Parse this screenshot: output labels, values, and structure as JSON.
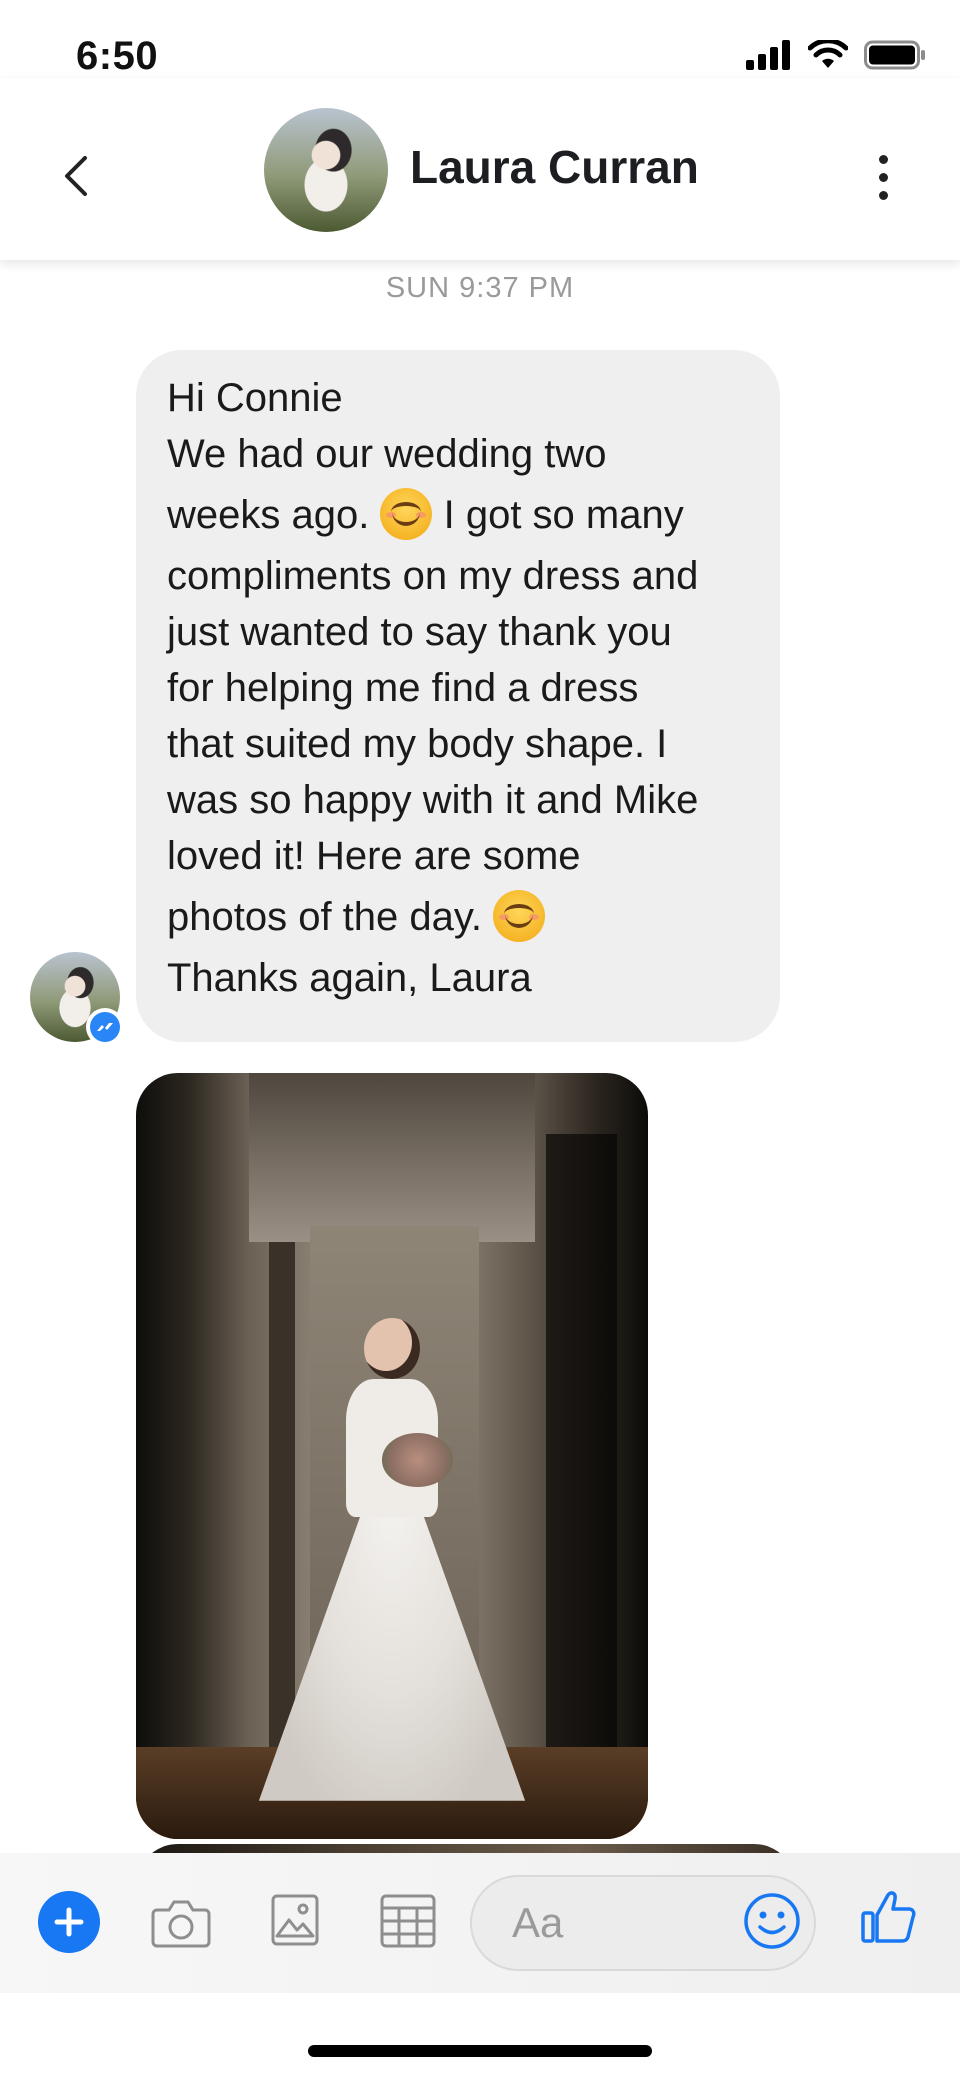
{
  "status_bar": {
    "time": "6:50"
  },
  "header": {
    "contact_name": "Laura Curran"
  },
  "conversation": {
    "timestamp": "SUN 9:37 PM",
    "message": {
      "lines": [
        "Hi Connie",
        "We had our wedding two",
        "weeks ago.",
        "I got so many",
        "compliments on my dress and",
        "just wanted to say thank you",
        "for helping me find a dress",
        "that suited my body shape. I",
        "was so happy with it and Mike",
        "loved it!  Here are some",
        "photos of the day.",
        "Thanks again, Laura"
      ]
    }
  },
  "composer": {
    "placeholder": "Aa"
  },
  "colors": {
    "accent": "#1877f2",
    "bubble": "#efefef",
    "timestamp": "#9a9a9a"
  }
}
